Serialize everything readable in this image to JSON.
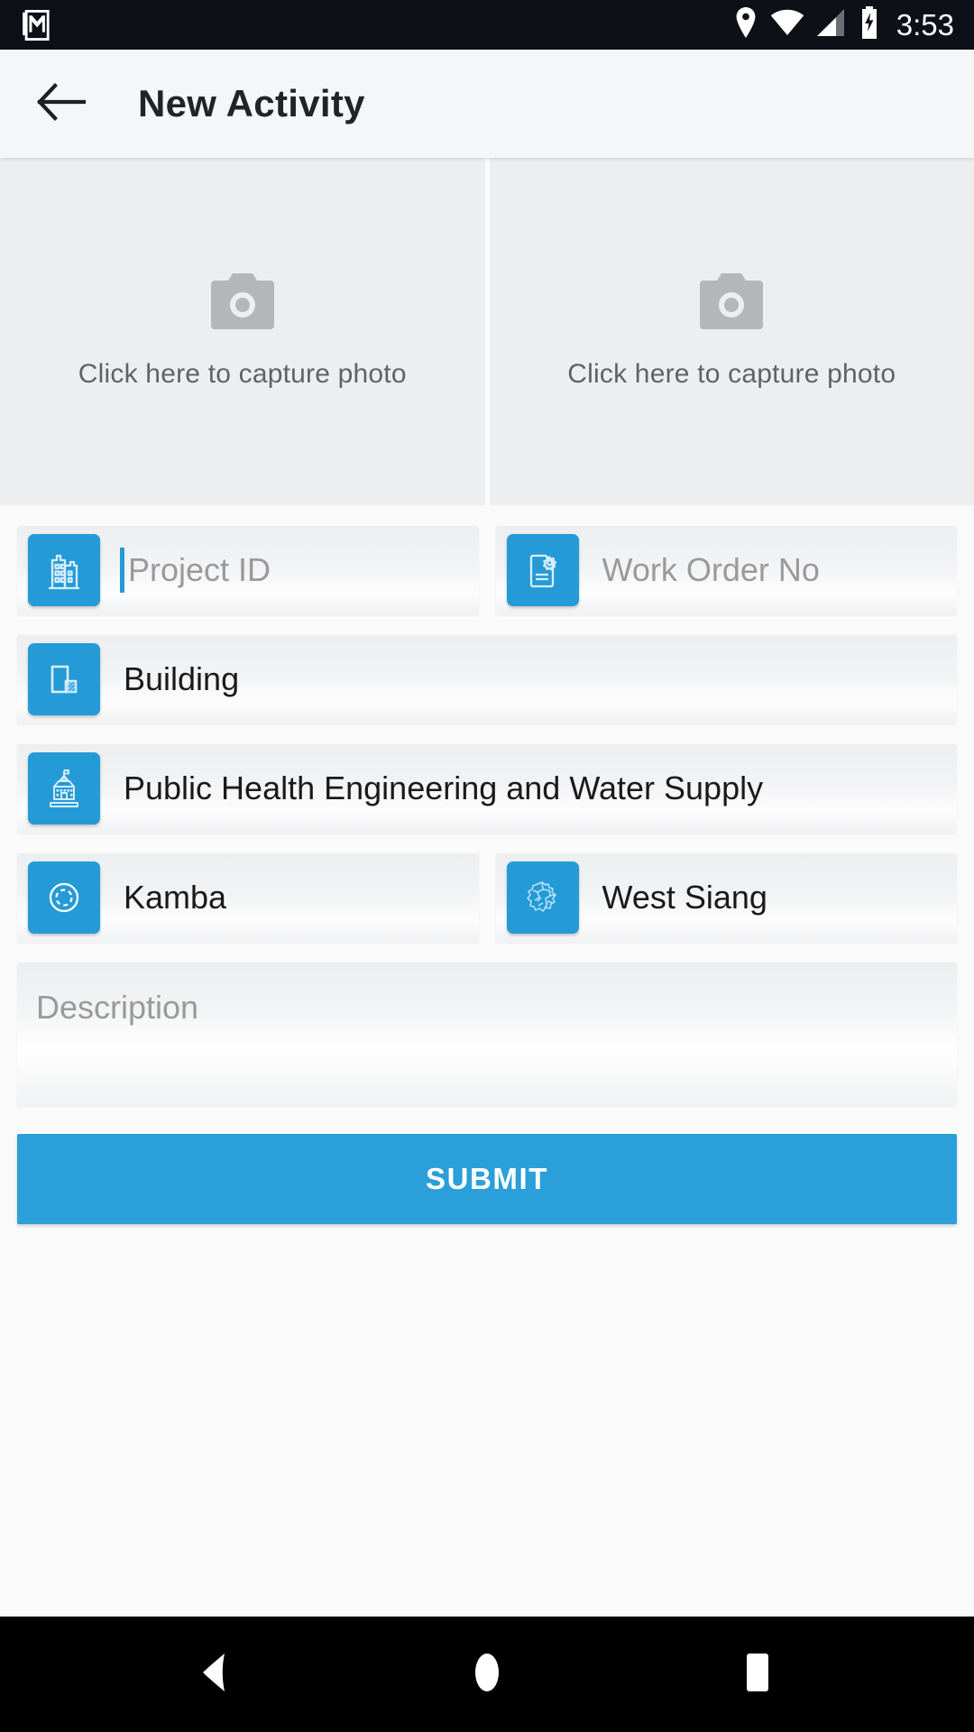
{
  "status_bar": {
    "notification_icon": "gmail-icon",
    "icons": [
      "location-pin-icon",
      "wifi-icon",
      "cellular-signal-icon",
      "battery-charging-icon"
    ],
    "clock": "3:53",
    "background_color": "#0d1016",
    "foreground_color": "#ffffff"
  },
  "app_bar": {
    "back_icon": "arrow-left-icon",
    "title": "New Activity",
    "background_color": "#f5f6f7",
    "title_color": "#20242a"
  },
  "photo_capture": {
    "icon": "camera-icon",
    "cells": [
      {
        "label": "Click here to capture photo"
      },
      {
        "label": "Click here to capture photo"
      }
    ]
  },
  "form": {
    "accent_color": "#249bd7",
    "rows": [
      {
        "fields": [
          {
            "icon": "building-icon",
            "value": "",
            "placeholder": "Project ID",
            "focused": true
          },
          {
            "icon": "work-order-document-icon",
            "value": "",
            "placeholder": "Work Order No",
            "focused": false
          }
        ]
      },
      {
        "fields": [
          {
            "icon": "structure-type-icon",
            "value": "Building",
            "placeholder": "",
            "focused": false
          }
        ]
      },
      {
        "fields": [
          {
            "icon": "government-building-icon",
            "value": "Public Health Engineering and Water Supply",
            "placeholder": "",
            "focused": false
          }
        ]
      },
      {
        "fields": [
          {
            "icon": "circle-location-icon",
            "value": "Kamba",
            "placeholder": "",
            "focused": false
          },
          {
            "icon": "district-map-icon",
            "value": "West Siang",
            "placeholder": "",
            "focused": false
          }
        ]
      }
    ],
    "description": {
      "placeholder": "Description",
      "value": ""
    },
    "submit_label": "SUBMIT",
    "submit_color": "#2b9fd9"
  },
  "nav_bar": {
    "background_color": "#000000",
    "buttons": [
      "back-nav-icon",
      "home-nav-icon",
      "recents-nav-icon"
    ]
  }
}
